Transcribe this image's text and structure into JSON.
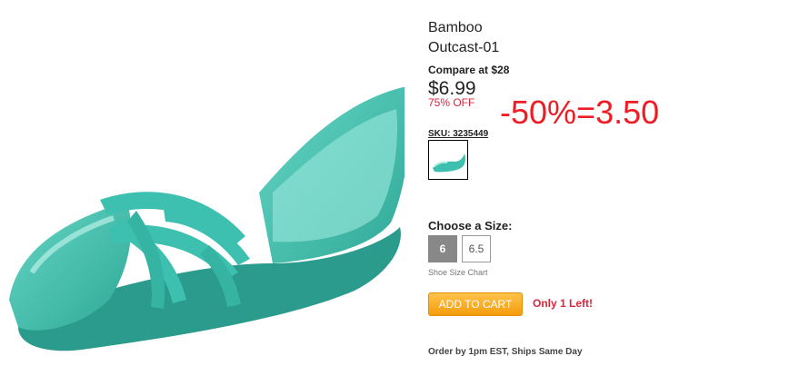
{
  "product": {
    "brand": "Bamboo",
    "model": "Outcast-01",
    "compare_at": "Compare at $28",
    "price": "$6.99",
    "discount": "75% OFF",
    "sku": "SKU: 3235449"
  },
  "annotation": {
    "text": "-50%=3.50",
    "color": "#ee1c24"
  },
  "sizes": {
    "label": "Choose a Size:",
    "options": [
      "6",
      "6.5"
    ],
    "selected": "6",
    "chart_link": "Shoe Size Chart"
  },
  "cart": {
    "button_label": "ADD TO CART",
    "stock_text": "Only 1 Left!"
  },
  "shipping": {
    "text": "Order by 1pm EST, Ships Same Day"
  },
  "colors": {
    "shoe": "#3ec0b0",
    "accent_red": "#e0243a",
    "cart_orange": "#f7a21a"
  }
}
